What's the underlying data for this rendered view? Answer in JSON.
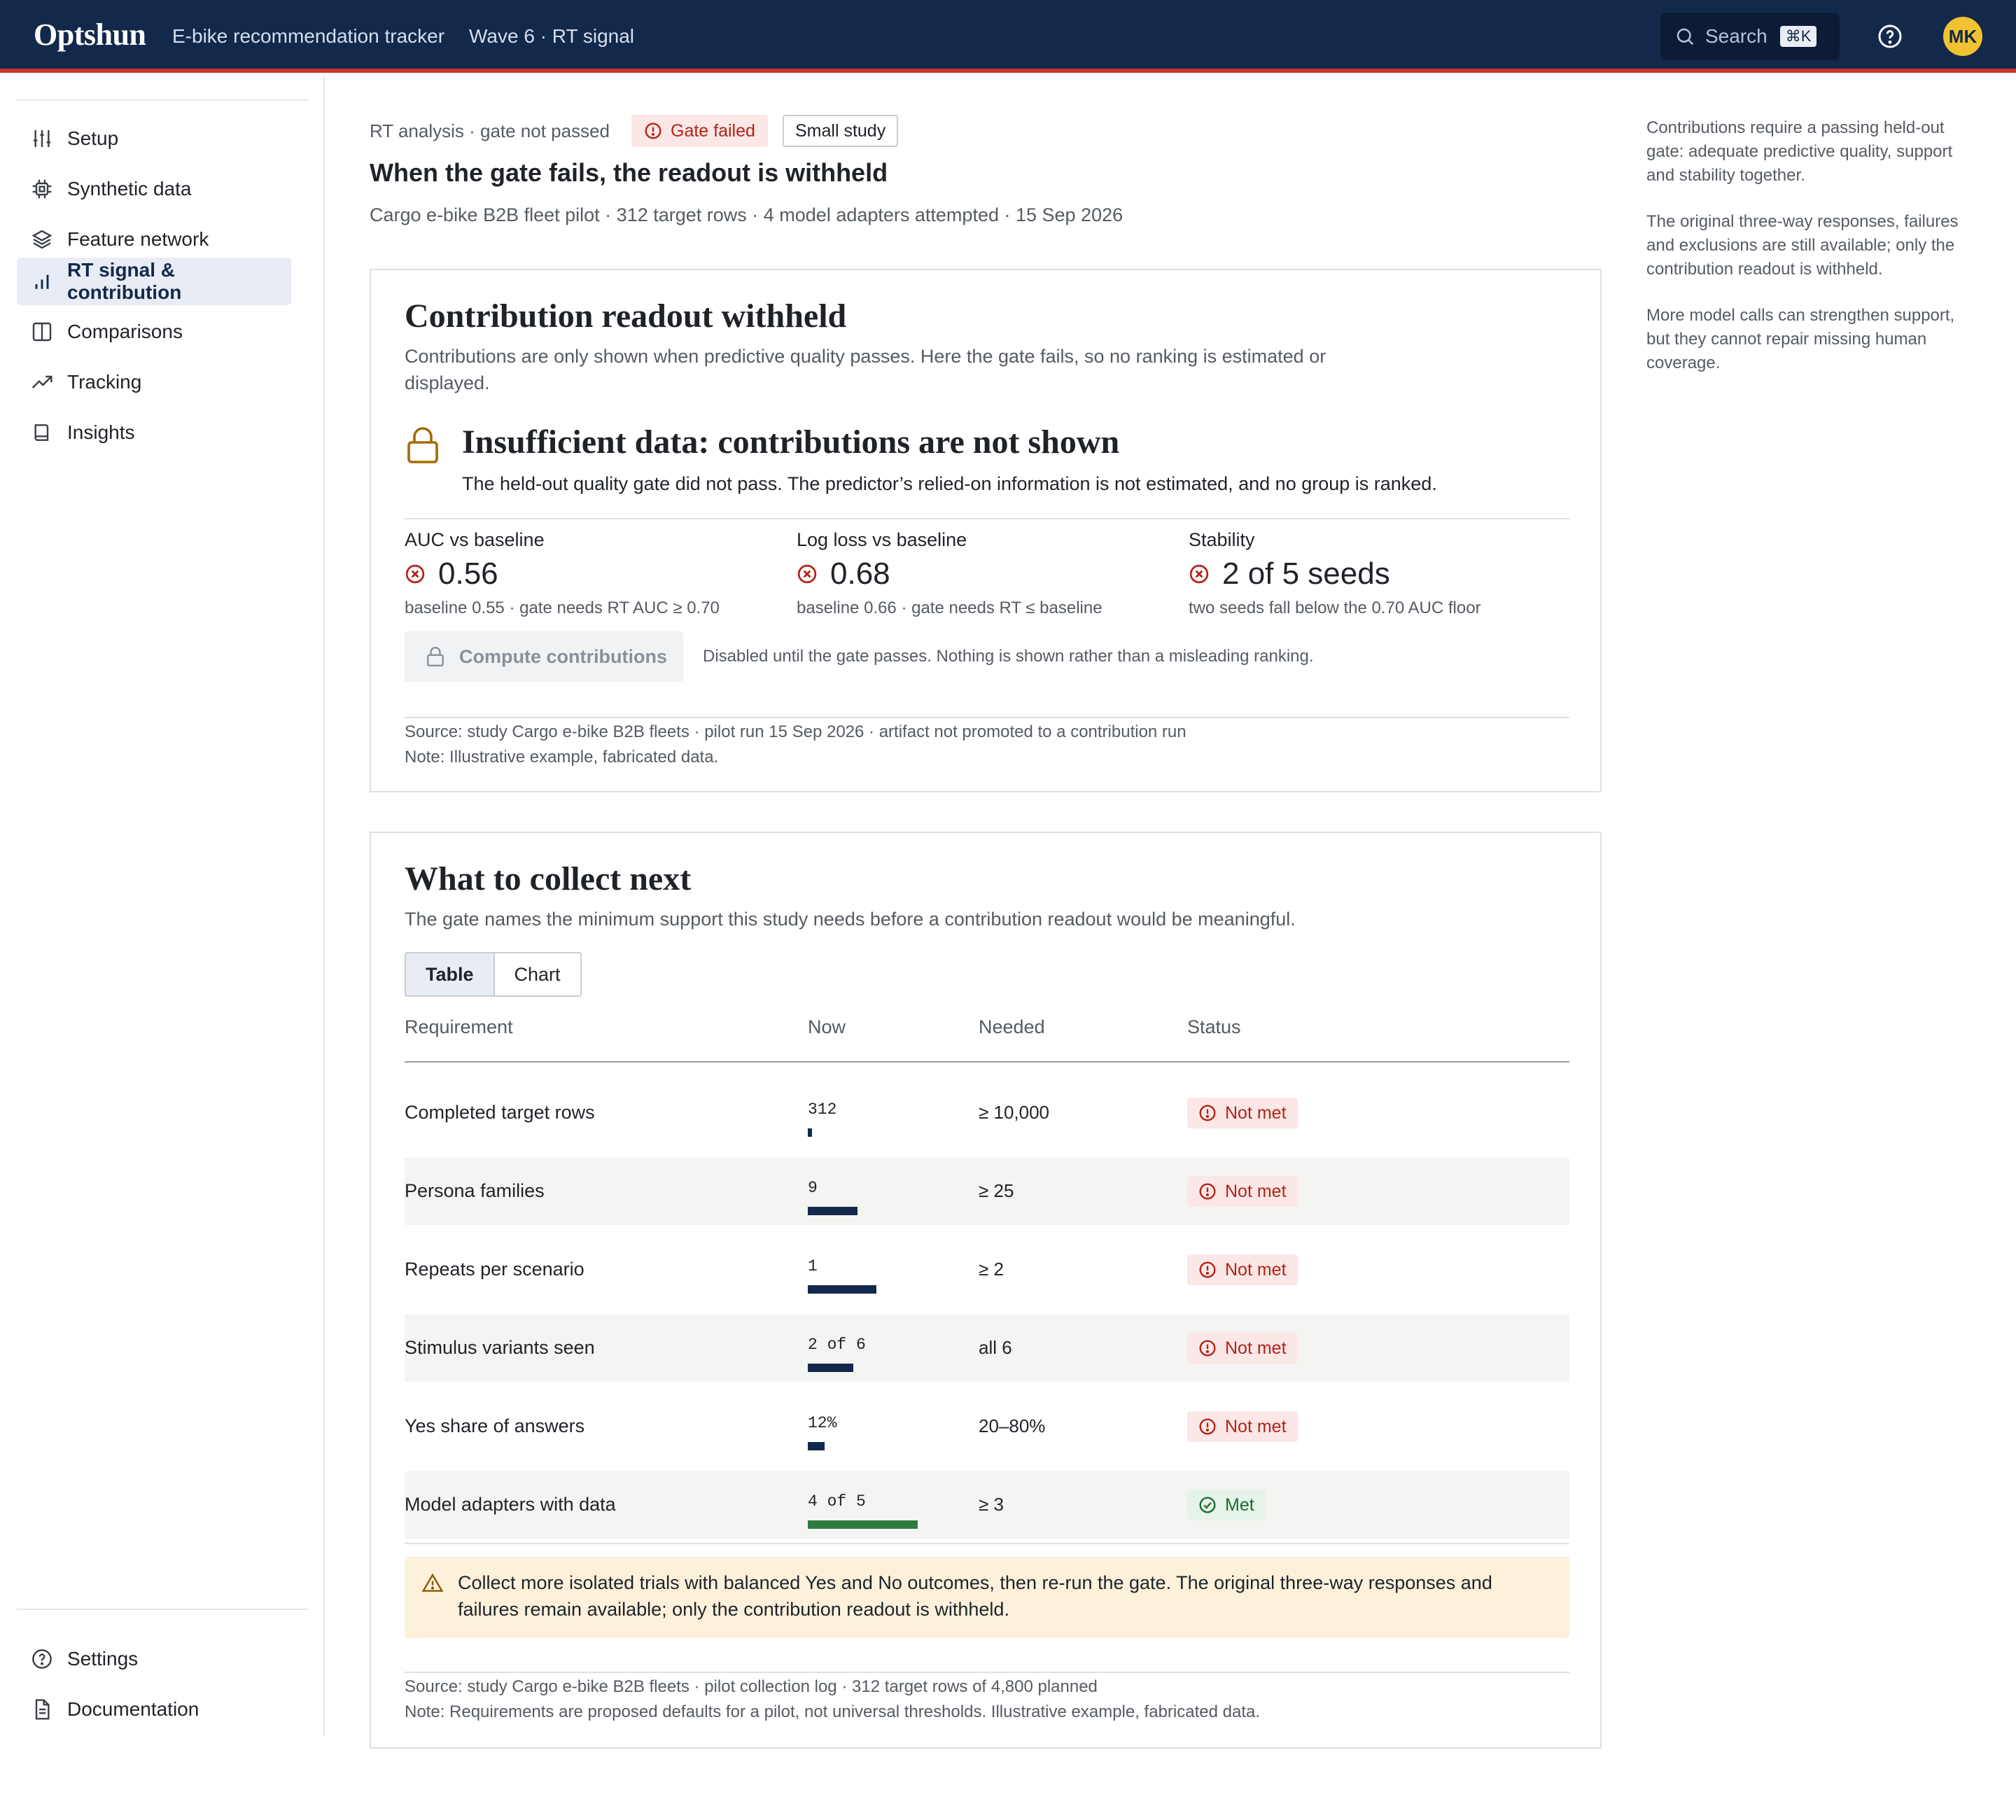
{
  "app": {
    "brand": "Optshun",
    "crumbs": [
      "E-bike recommendation tracker",
      "Wave 6 · RT signal"
    ],
    "search_label": "Search",
    "search_shortcut": "⌘K",
    "avatar_initials": "MK"
  },
  "sidebar": {
    "items": [
      {
        "label": "Setup",
        "icon": "sliders-icon"
      },
      {
        "label": "Synthetic data",
        "icon": "chip-icon"
      },
      {
        "label": "Feature network",
        "icon": "layers-icon"
      },
      {
        "label": "RT signal & contribution",
        "icon": "bar-chart-icon",
        "active": true
      },
      {
        "label": "Comparisons",
        "icon": "columns-icon"
      },
      {
        "label": "Tracking",
        "icon": "trend-icon"
      },
      {
        "label": "Insights",
        "icon": "book-icon"
      }
    ],
    "bottom": [
      {
        "label": "Settings",
        "icon": "help-circle-icon"
      },
      {
        "label": "Documentation",
        "icon": "document-icon"
      }
    ]
  },
  "header": {
    "eyebrow": "RT analysis · gate not passed",
    "badge_failed": "Gate failed",
    "badge_small": "Small study",
    "title": "When the gate fails, the readout is withheld",
    "meta": "Cargo e-bike B2B fleet pilot · 312 target rows · 4 model adapters attempted · 15 Sep 2026"
  },
  "notes": [
    "Contributions require a passing held-out gate: adequate predictive quality, support and stability together.",
    "The original three-way responses, failures and exclusions are still available; only the contribution readout is withheld.",
    "More model calls can strengthen support, but they cannot repair missing human coverage."
  ],
  "readout": {
    "title": "Contribution readout withheld",
    "sub_line1": "Contributions are only shown when predictive quality passes. Here the gate fails, so no ranking is estimated or",
    "sub_line2": "displayed.",
    "insuf_title": "Insufficient data: contributions are not shown",
    "insuf_sub": "The held-out quality gate did not pass. The predictor’s relied-on information is not estimated, and no group is ranked.",
    "metrics": [
      {
        "label": "AUC vs baseline",
        "value": "0.56",
        "note": "baseline 0.55 · gate needs RT AUC ≥ 0.70"
      },
      {
        "label": "Log loss vs baseline",
        "value": "0.68",
        "note": "baseline 0.66 · gate needs RT ≤ baseline"
      },
      {
        "label": "Stability",
        "value": "2 of 5 seeds",
        "note": "two seeds fall below the 0.70 AUC floor"
      }
    ],
    "compute_label": "Compute contributions",
    "compute_note": "Disabled until the gate passes. Nothing is shown rather than a misleading ranking.",
    "source": "Source: study Cargo e-bike B2B fleets · pilot run 15 Sep 2026 · artifact not promoted to a contribution run",
    "note": "Note: Illustrative example, fabricated data."
  },
  "collect": {
    "title": "What to collect next",
    "sub": "The gate names the minimum support this study needs before a contribution readout would be meaningful.",
    "toggle": [
      "Table",
      "Chart"
    ],
    "headers": [
      "Requirement",
      "Now",
      "Needed",
      "Status"
    ],
    "rows": [
      {
        "req": "Completed target rows",
        "now": "312",
        "needed": "≥ 10,000",
        "status": "Not met",
        "met": false,
        "progress": 0.03
      },
      {
        "req": "Persona families",
        "now": "9",
        "needed": "≥ 25",
        "status": "Not met",
        "met": false,
        "progress": 0.36
      },
      {
        "req": "Repeats per scenario",
        "now": "1",
        "needed": "≥ 2",
        "status": "Not met",
        "met": false,
        "progress": 0.5
      },
      {
        "req": "Stimulus variants seen",
        "now": "2 of 6",
        "needed": "all 6",
        "status": "Not met",
        "met": false,
        "progress": 0.33
      },
      {
        "req": "Yes share of answers",
        "now": "12%",
        "needed": "20–80%",
        "status": "Not met",
        "met": false,
        "progress": 0.12
      },
      {
        "req": "Model adapters with data",
        "now": "4 of 5",
        "needed": "≥ 3",
        "status": "Met",
        "met": true,
        "progress": 0.8
      }
    ],
    "callout_line1": "Collect more isolated trials with balanced Yes and No outcomes, then re-run the gate. The original three-way responses and",
    "callout_line2": "failures remain available; only the contribution readout is withheld.",
    "source": "Source: study Cargo e-bike B2B fleets · pilot collection log · 312 target rows of 4,800 planned",
    "note": "Note: Requirements are proposed defaults for a pilot, not universal thresholds. Illustrative example, fabricated data."
  },
  "colors": {
    "navy": "#13294b",
    "accent_red": "#c8332f",
    "fail": "#b42318",
    "pass": "#1d6b31",
    "warn_bg": "#fdf1dc"
  }
}
